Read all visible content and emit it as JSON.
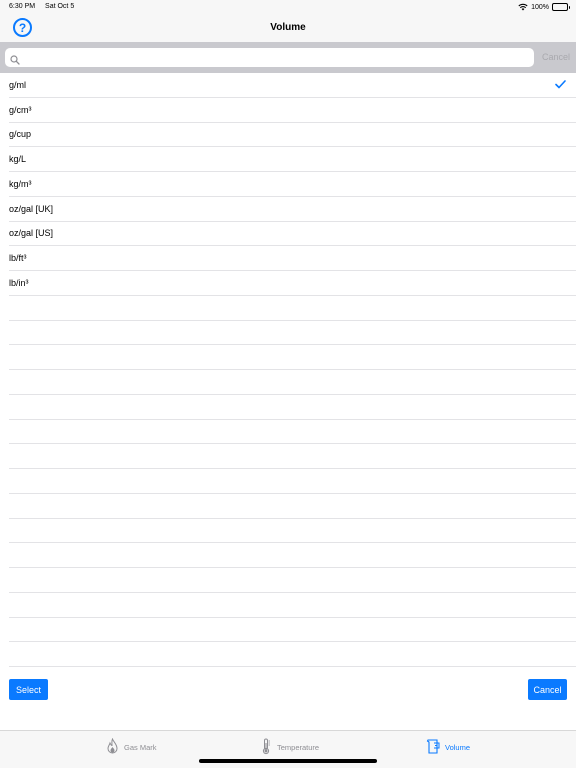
{
  "status_bar": {
    "time": "6:30 PM",
    "date": "Sat Oct 5",
    "battery": "100%"
  },
  "nav": {
    "title": "Volume",
    "help_symbol": "?"
  },
  "search": {
    "value": "",
    "placeholder": "",
    "cancel_label": "Cancel"
  },
  "units": [
    {
      "label": "g/ml",
      "selected": true
    },
    {
      "label": "g/cm³",
      "selected": false
    },
    {
      "label": "g/cup",
      "selected": false
    },
    {
      "label": "kg/L",
      "selected": false
    },
    {
      "label": "kg/m³",
      "selected": false
    },
    {
      "label": "oz/gal [UK]",
      "selected": false
    },
    {
      "label": "oz/gal [US]",
      "selected": false
    },
    {
      "label": "lb/ft³",
      "selected": false
    },
    {
      "label": "lb/in³",
      "selected": false
    }
  ],
  "actions": {
    "select_label": "Select",
    "cancel_label": "Cancel"
  },
  "tabs": [
    {
      "label": "Gas Mark",
      "icon": "flame-icon",
      "active": false
    },
    {
      "label": "Temperature",
      "icon": "thermometer-icon",
      "active": false
    },
    {
      "label": "Volume",
      "icon": "measuring-cup-icon",
      "active": true
    }
  ],
  "colors": {
    "accent": "#0a7aff",
    "inactive": "#8e8e93",
    "search_bg": "#c9c9ce"
  }
}
